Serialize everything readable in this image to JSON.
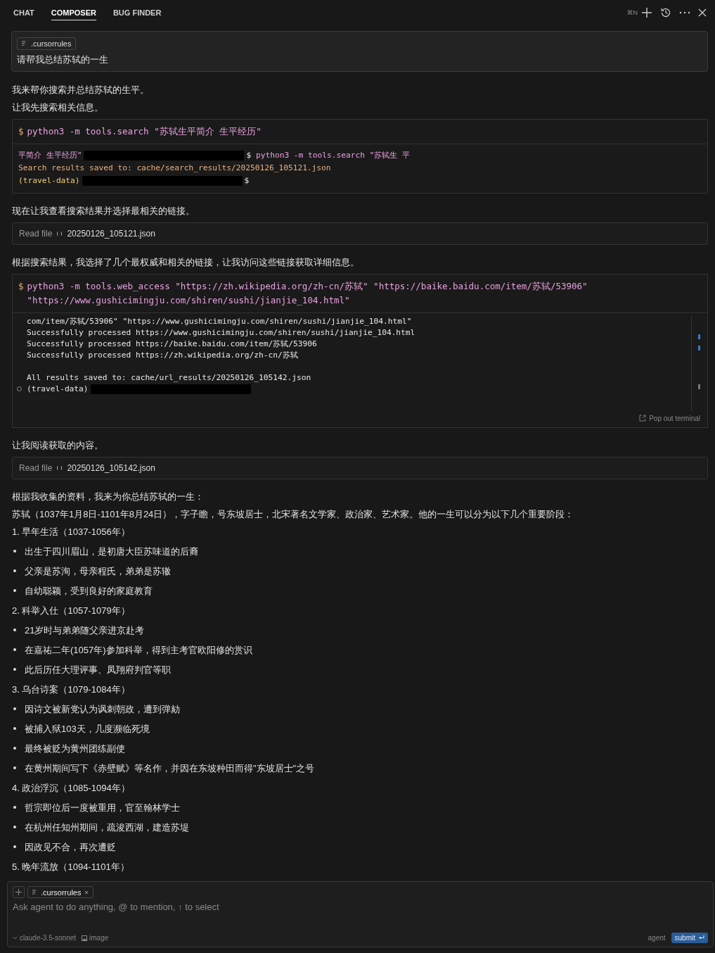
{
  "tabs": [
    {
      "label": "CHAT",
      "selected": false
    },
    {
      "label": "COMPOSER",
      "selected": true
    },
    {
      "label": "BUG FINDER",
      "selected": false
    }
  ],
  "header_shortcut": "⌘N",
  "prompt": {
    "chip": ".cursorrules",
    "text": "请帮我总结苏轼的一生"
  },
  "messages": [
    {
      "kind": "text",
      "text": "我来帮你搜索并总结苏轼的生平。"
    },
    {
      "kind": "text",
      "text": "让我先搜索相关信息。"
    },
    {
      "kind": "terminal",
      "prompt": "$",
      "command": "python3 -m tools.search \"苏轼生平简介 生平经历\"",
      "output": [
        {
          "kind": "line",
          "segments": [
            {
              "kind": "pink",
              "text": "平简介 生平经历\""
            },
            {
              "kind": "redaction"
            },
            {
              "kind": "plain",
              "text": "$"
            },
            {
              "kind": "pink",
              "text": " python3 -m tools.search \"苏轼生 平"
            }
          ]
        },
        {
          "kind": "line",
          "segments": [
            {
              "kind": "orange",
              "text": "Search results saved to: cache/search_results/20250126_105121.json"
            }
          ]
        },
        {
          "kind": "line",
          "segments": [
            {
              "kind": "yellow",
              "text": "(travel-data)"
            },
            {
              "kind": "redaction"
            },
            {
              "kind": "plain",
              "text": "$"
            }
          ]
        }
      ]
    },
    {
      "kind": "text",
      "text": "现在让我查看搜索结果并选择最相关的链接。"
    },
    {
      "kind": "read_file",
      "label": "Read file",
      "file": "20250126_105121.json"
    },
    {
      "kind": "text",
      "text": "根据搜索结果，我选择了几个最权威和相关的链接，让我访问这些链接获取详细信息。"
    },
    {
      "kind": "terminal",
      "prompt": "$",
      "command": "python3 -m tools.web_access \"https://zh.wikipedia.org/zh-cn/苏轼\" \"https://baike.baidu.com/item/苏轼/53906\" \"https://www.gushicimingju.com/shiren/sushi/jianjie_104.html\"",
      "popout": "Pop out terminal",
      "output": [
        {
          "kind": "line",
          "segments": [
            {
              "kind": "plain",
              "text": "com/item/苏轼/53906\" \"https://www.gushicimingju.com/shiren/sushi/jianjie_104.html\""
            }
          ]
        },
        {
          "kind": "line",
          "segments": [
            {
              "kind": "plain",
              "text": "Successfully processed https://www.gushicimingju.com/shiren/sushi/jianjie_104.html"
            }
          ]
        },
        {
          "kind": "line",
          "segments": [
            {
              "kind": "plain",
              "text": "Successfully processed https://baike.baidu.com/item/苏轼/53906"
            }
          ]
        },
        {
          "kind": "line",
          "segments": [
            {
              "kind": "plain",
              "text": "Successfully processed https://zh.wikipedia.org/zh-cn/苏轼"
            }
          ]
        },
        {
          "kind": "blank"
        },
        {
          "kind": "line",
          "segments": [
            {
              "kind": "plain",
              "text": "All results saved to: cache/url_results/20250126_105142.json"
            }
          ]
        },
        {
          "kind": "line",
          "segments": [
            {
              "kind": "circle"
            },
            {
              "kind": "plain",
              "text": "(travel-data)"
            },
            {
              "kind": "redaction"
            }
          ]
        }
      ]
    },
    {
      "kind": "text",
      "text": "让我阅读获取的内容。"
    },
    {
      "kind": "read_file",
      "label": "Read file",
      "file": "20250126_105142.json"
    },
    {
      "kind": "text",
      "text": "根据我收集的资料，我来为你总结苏轼的一生："
    },
    {
      "kind": "text",
      "text": "苏轼（1037年1月8日-1101年8月24日），字子瞻，号东坡居士，北宋著名文学家、政治家、艺术家。他的一生可以分为以下几个重要阶段："
    },
    {
      "kind": "heading",
      "text": "1. 早年生活（1037-1056年）"
    },
    {
      "kind": "bullet",
      "text": "出生于四川眉山，是初唐大臣苏味道的后裔"
    },
    {
      "kind": "bullet",
      "text": "父亲是苏洵，母亲程氏，弟弟是苏辙"
    },
    {
      "kind": "bullet",
      "text": "自幼聪颖，受到良好的家庭教育"
    },
    {
      "kind": "heading",
      "text": "2. 科举入仕（1057-1079年）"
    },
    {
      "kind": "bullet",
      "text": "21岁时与弟弟随父亲进京赴考"
    },
    {
      "kind": "bullet",
      "text": "在嘉祐二年(1057年)参加科举，得到主考官欧阳修的赏识"
    },
    {
      "kind": "bullet",
      "text": "此后历任大理评事、凤翔府判官等职"
    },
    {
      "kind": "heading",
      "text": "3. 乌台诗案（1079-1084年）"
    },
    {
      "kind": "bullet",
      "text": "因诗文被新党认为讽刺朝政，遭到弹劾"
    },
    {
      "kind": "bullet",
      "text": "被捕入狱103天，几度濒临死境"
    },
    {
      "kind": "bullet",
      "text": "最终被贬为黄州团练副使"
    },
    {
      "kind": "bullet",
      "text": "在黄州期间写下《赤壁赋》等名作，并因在东坡种田而得\"东坡居士\"之号"
    },
    {
      "kind": "heading",
      "text": "4. 政治浮沉（1085-1094年）"
    },
    {
      "kind": "bullet",
      "text": "哲宗即位后一度被重用，官至翰林学士"
    },
    {
      "kind": "bullet",
      "text": "在杭州任知州期间，疏浚西湖，建造苏堤"
    },
    {
      "kind": "bullet",
      "text": "因政见不合，再次遭贬"
    },
    {
      "kind": "heading",
      "text": "5. 晚年流放（1094-1101年）"
    }
  ],
  "composer": {
    "chip": ".cursorrules",
    "placeholder": "Ask agent to do anything, @ to mention, ↑ to select",
    "model": "claude-3.5-sonnet",
    "image_label": "image",
    "mode": "agent",
    "submit": "submit"
  }
}
